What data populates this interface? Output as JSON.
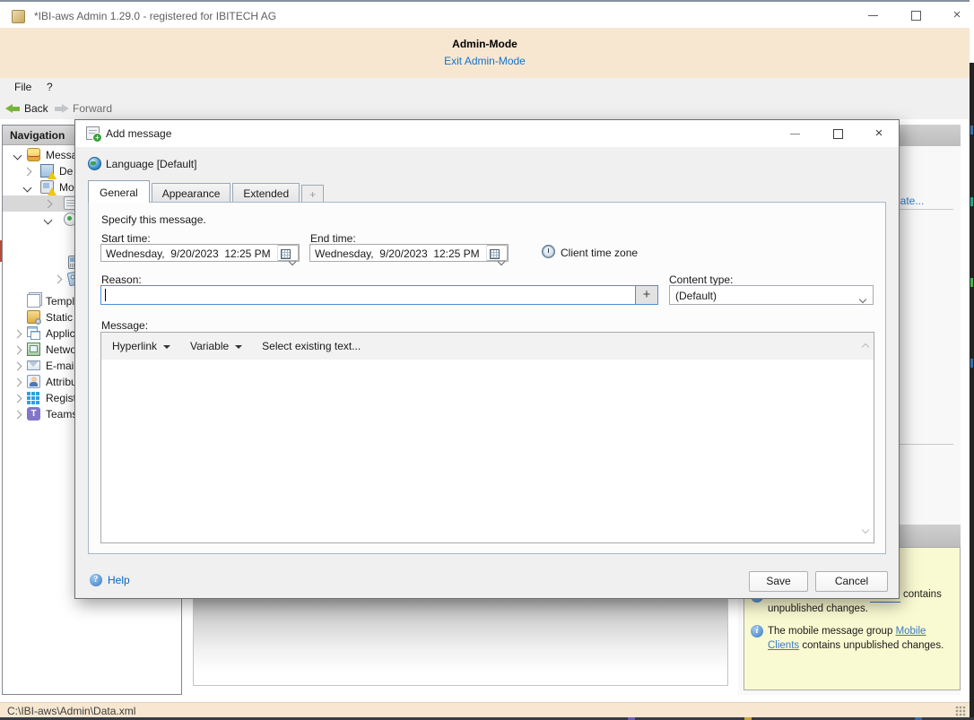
{
  "window": {
    "title": "*IBI-aws Admin 1.29.0 - registered for IBITECH AG"
  },
  "banner": {
    "title": "Admin-Mode",
    "exit_link": "Exit Admin-Mode"
  },
  "menubar": {
    "items": [
      "File",
      "?"
    ]
  },
  "toolbar": {
    "back": "Back",
    "forward": "Forward"
  },
  "navigation": {
    "header": "Navigation",
    "items": [
      {
        "label": "Messa",
        "icon": "messages",
        "level": 0,
        "chevron": "expanded"
      },
      {
        "label": "De",
        "icon": "desktop-warning",
        "level": 1,
        "chevron": "collapsed"
      },
      {
        "label": "Mo",
        "icon": "mobile-warning",
        "level": 1,
        "chevron": "expanded"
      },
      {
        "label": "",
        "icon": "message-group",
        "level": 2,
        "chevron": "collapsed",
        "selected": true
      },
      {
        "label": "",
        "icon": "maintenance",
        "level": 2,
        "chevron": "expanded"
      },
      {
        "label": "",
        "icon": "mobile-phone",
        "level": 3,
        "chevron": "none"
      },
      {
        "label": "",
        "icon": "tag",
        "level": 3,
        "chevron": "collapsed"
      },
      {
        "label": "Templ",
        "icon": "templates",
        "level": 0,
        "chevron": "none"
      },
      {
        "label": "Static",
        "icon": "static",
        "level": 0,
        "chevron": "none"
      },
      {
        "label": "Applic",
        "icon": "applications",
        "level": 0,
        "chevron": "collapsed"
      },
      {
        "label": "Netwo",
        "icon": "network",
        "level": 0,
        "chevron": "collapsed"
      },
      {
        "label": "E-mail",
        "icon": "email",
        "level": 0,
        "chevron": "collapsed"
      },
      {
        "label": "Attribu",
        "icon": "attributes",
        "level": 0,
        "chevron": "collapsed"
      },
      {
        "label": "Regist",
        "icon": "registry",
        "level": 0,
        "chevron": "collapsed"
      },
      {
        "label": "Teams",
        "icon": "teams",
        "level": 0,
        "chevron": "collapsed"
      }
    ]
  },
  "dialog": {
    "title": "Add message",
    "language_label": "Language [Default]",
    "tabs": [
      {
        "label": "General",
        "active": true
      },
      {
        "label": "Appearance"
      },
      {
        "label": "Extended"
      },
      {
        "label": "+"
      }
    ],
    "general": {
      "instruction": "Specify this message.",
      "start_time": {
        "label": "Start time:",
        "value": "Wednesday,  9/20/2023  12:25 PM"
      },
      "end_time": {
        "label": "End time:",
        "value": "Wednesday,  9/20/2023  12:25 PM"
      },
      "client_time_zone": "Client time zone",
      "reason": {
        "label": "Reason:",
        "value": "",
        "add_button": "+"
      },
      "content_type": {
        "label": "Content type:",
        "value": "(Default)"
      },
      "message": {
        "label": "Message:",
        "toolbar": [
          {
            "name": "hyperlink",
            "label": "Hyperlink",
            "dropdown": true
          },
          {
            "name": "variable",
            "label": "Variable",
            "dropdown": true
          },
          {
            "name": "select-existing-text",
            "label": "Select existing text...",
            "dropdown": false
          }
        ]
      }
    },
    "footer": {
      "help": "Help",
      "save": "Save",
      "cancel": "Cancel"
    }
  },
  "right_panel": {
    "partial_link": "late...",
    "notifications": [
      {
        "visible_line1": "contains",
        "visible_line2": "unpublished changes."
      },
      {
        "prefix": "The mobile message group ",
        "link": "Mobile Clients",
        "suffix": " contains unpublished changes."
      }
    ]
  },
  "statusbar": {
    "path": "C:\\IBI-aws\\Admin\\Data.xml"
  }
}
